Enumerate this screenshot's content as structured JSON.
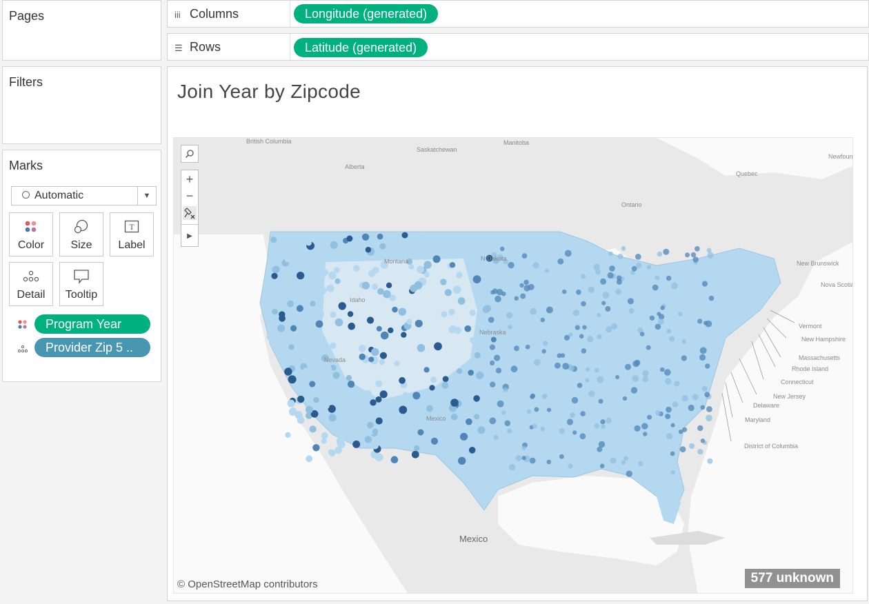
{
  "left_panel": {
    "pages_title": "Pages",
    "filters_title": "Filters",
    "marks_title": "Marks",
    "mark_type": "Automatic",
    "mark_buttons": [
      {
        "label": "Color"
      },
      {
        "label": "Size"
      },
      {
        "label": "Label"
      },
      {
        "label": "Detail"
      },
      {
        "label": "Tooltip"
      }
    ],
    "mark_pills": [
      {
        "label": "Program Year",
        "color": "#00b180"
      },
      {
        "label": "Provider Zip 5 ..",
        "color": "#4996b2"
      }
    ]
  },
  "shelves": {
    "columns_label": "Columns",
    "columns_pill": "Longitude (generated)",
    "rows_label": "Rows",
    "rows_pill": "Latitude (generated)"
  },
  "view": {
    "title": "Join Year by Zipcode",
    "attribution": "© OpenStreetMap contributors",
    "unknown_badge": "577 unknown",
    "map_labels": {
      "british_columbia": "British Columbia",
      "alberta": "Alberta",
      "saskatchewan": "Saskatchewan",
      "manitoba": "Manitoba",
      "ontario": "Ontario",
      "quebec": "Quebec",
      "newfoundland": "Newfound and Labrado",
      "new_brunswick": "New Brunswick",
      "nova_scotia": "Nova Scotia",
      "vermont": "Vermont",
      "new_hampshire": "New Hampshire",
      "massachusetts": "Massachusetts",
      "rhode_island": "Rhode Island",
      "connecticut": "Connecticut",
      "new_jersey": "New Jersey",
      "delaware": "Delaware",
      "maryland": "Maryland",
      "dc": "District of Columbia",
      "mexico": "Mexico",
      "nevada": "Nevada",
      "idaho": "Idaho",
      "montana": "Montana",
      "n_dakota": "N Dakota",
      "nebraska": "Nebraska",
      "new_mexico": "Mexico"
    },
    "colors": {
      "light": "#b4d8ef",
      "mid": "#8fc0e0",
      "dark": "#4f86b8",
      "darkest": "#2a5a8e"
    }
  }
}
